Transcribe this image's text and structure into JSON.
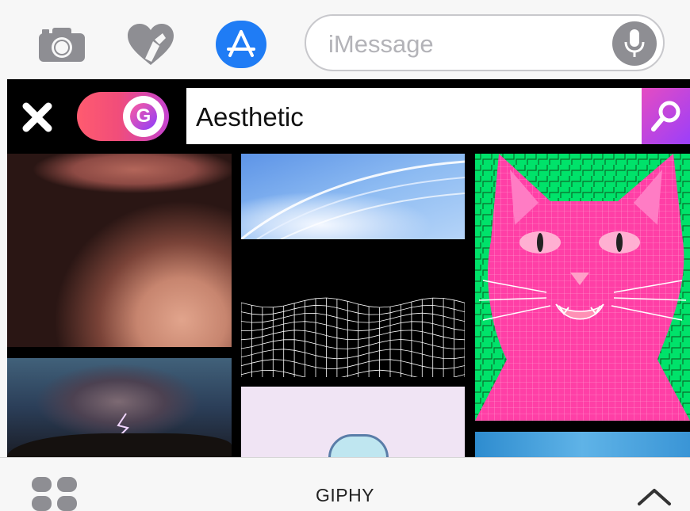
{
  "message_bar": {
    "placeholder": "iMessage",
    "icons": [
      "camera-icon",
      "digital-touch-heart-icon",
      "app-store-icon",
      "microphone-icon"
    ],
    "accent_color": "#1f7cf5"
  },
  "giphy": {
    "search_value": "Aesthetic",
    "toggle_letter": "G",
    "icons": [
      "close-icon",
      "search-icon"
    ],
    "results": [
      {
        "name": "gif-lips"
      },
      {
        "name": "gif-storm-cloud"
      },
      {
        "name": "gif-anime-sky"
      },
      {
        "name": "gif-wireframe-grid"
      },
      {
        "name": "gif-pastel-character"
      },
      {
        "name": "gif-pink-wireframe-cat"
      },
      {
        "name": "gif-blue-water"
      }
    ]
  },
  "bottom_bar": {
    "title": "GIPHY",
    "icons": [
      "app-drawer-icon",
      "chevron-up-icon"
    ]
  }
}
